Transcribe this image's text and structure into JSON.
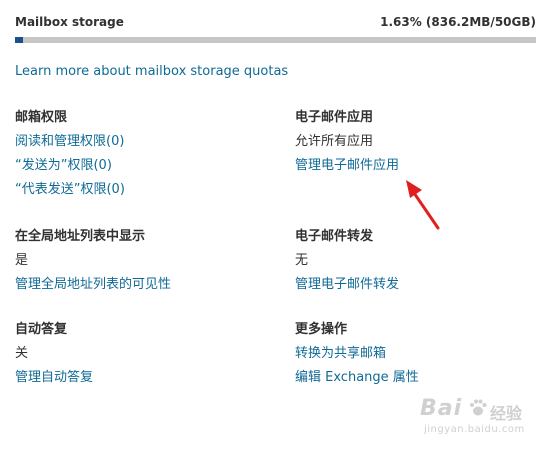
{
  "storage": {
    "title": "Mailbox storage",
    "usage_text": "1.63% (836.2MB/50GB)",
    "percent_used": 1.63
  },
  "learn_more": "Learn more about mailbox storage quotas",
  "sections": {
    "mailbox_permissions": {
      "title": "邮箱权限",
      "links": [
        "阅读和管理权限(0)",
        "“发送为”权限(0)",
        "“代表发送”权限(0)"
      ]
    },
    "email_apps": {
      "title": "电子邮件应用",
      "value": "允许所有应用",
      "link": "管理电子邮件应用"
    },
    "gal": {
      "title": "在全局地址列表中显示",
      "value": "是",
      "link": "管理全局地址列表的可见性"
    },
    "forwarding": {
      "title": "电子邮件转发",
      "value": "无",
      "link": "管理电子邮件转发"
    },
    "auto_reply": {
      "title": "自动答复",
      "value": "关",
      "link": "管理自动答复"
    },
    "more_actions": {
      "title": "更多操作",
      "links": [
        "转换为共享邮箱",
        "编辑 Exchange 属性"
      ]
    }
  },
  "annotation": {
    "arrow_color": "#e02020",
    "icon": "red-arrow-icon"
  },
  "watermark": {
    "brand": "Bai",
    "brand_cn": "经验",
    "url": "jingyan.baidu.com",
    "icon": "paw-icon"
  },
  "colors": {
    "link": "#0f6a96",
    "bar_track": "#c8c6c4",
    "bar_fill": "#1b4e8d"
  }
}
